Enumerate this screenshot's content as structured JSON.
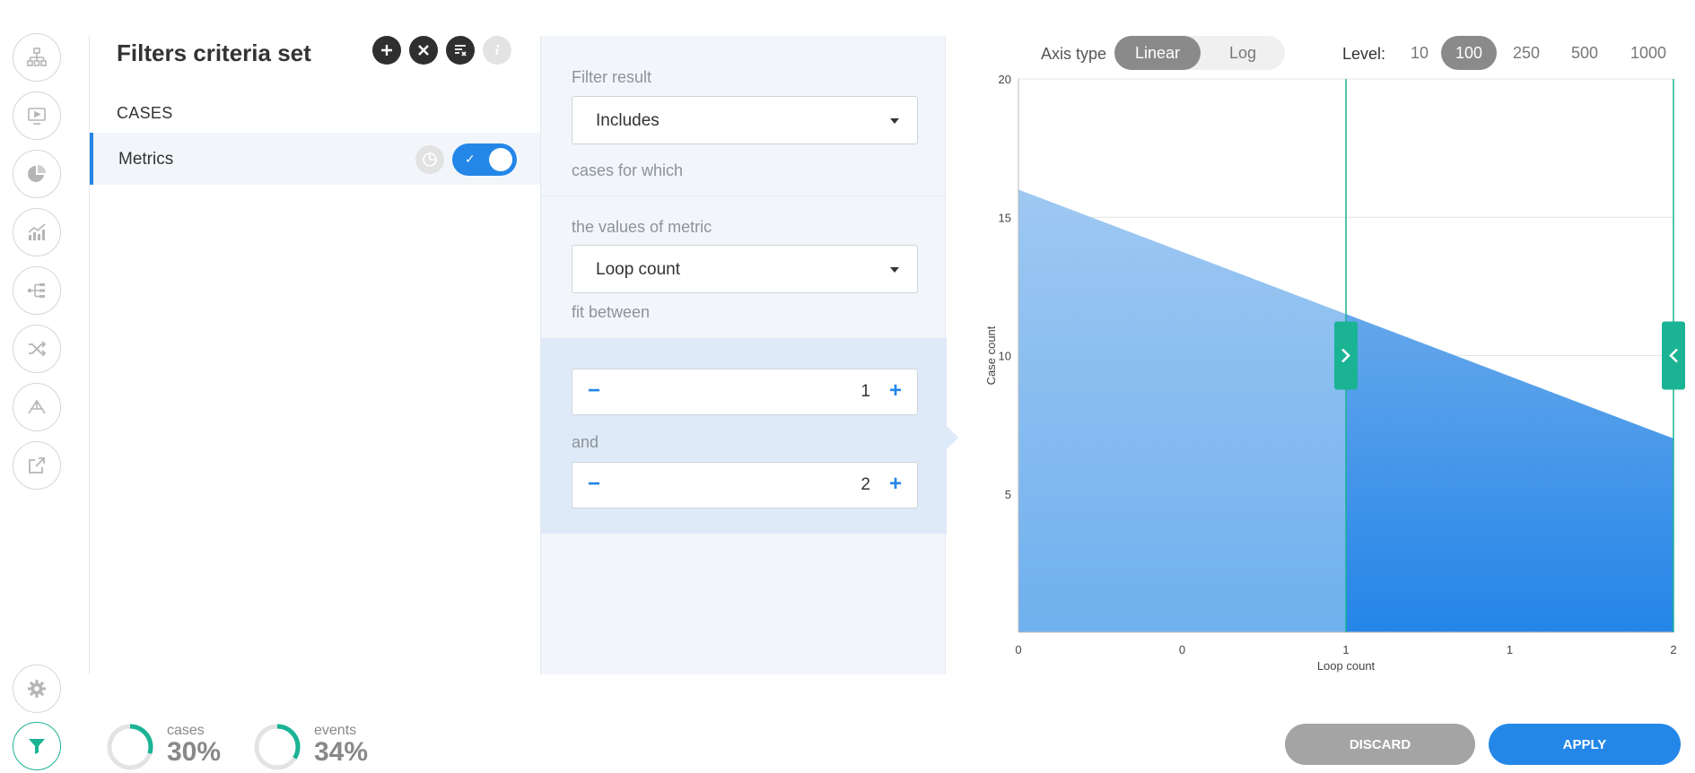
{
  "rail": {
    "items": [
      {
        "name": "process-map-icon"
      },
      {
        "name": "dashboard-icon"
      },
      {
        "name": "pie-chart-icon"
      },
      {
        "name": "statistics-icon"
      },
      {
        "name": "variants-icon"
      },
      {
        "name": "shuffle-icon"
      },
      {
        "name": "social-network-icon"
      },
      {
        "name": "export-icon"
      }
    ],
    "settings_icon": "gear-icon",
    "filter_icon": "filter-icon"
  },
  "filters": {
    "title": "Filters criteria set",
    "section": "CASES",
    "item_label": "Metrics",
    "toggle_on": true
  },
  "criteria": {
    "filter_result_label": "Filter result",
    "filter_result_value": "Includes",
    "cases_for_which": "cases for which",
    "metric_label": "the values of metric",
    "metric_value": "Loop count",
    "fit_between": "fit between",
    "min_value": "1",
    "and_label": "and",
    "max_value": "2",
    "minus": "−",
    "plus": "+"
  },
  "axis_type": {
    "label": "Axis type",
    "options": [
      "Linear",
      "Log"
    ],
    "selected": "Linear"
  },
  "level": {
    "label": "Level:",
    "options": [
      "10",
      "100",
      "250",
      "500",
      "1000"
    ],
    "selected": "100"
  },
  "chart_data": {
    "type": "area",
    "title": "",
    "xlabel": "Loop count",
    "ylabel": "Case count",
    "x": [
      0,
      2
    ],
    "values": [
      16,
      7
    ],
    "xticks": [
      "0",
      "0",
      "1",
      "1",
      "2"
    ],
    "yticks": [
      "5",
      "10",
      "15",
      "20"
    ],
    "ylim": [
      0,
      20
    ],
    "xlim": [
      0,
      2
    ],
    "selection": [
      1,
      2
    ],
    "grid": true,
    "colors": {
      "area": "#8cc0f1",
      "selected": "#2f8ae8",
      "handle": "#1ab394"
    }
  },
  "footer": {
    "cases_label": "cases",
    "cases_pct": "30%",
    "cases_frac": 0.3,
    "events_label": "events",
    "events_pct": "34%",
    "events_frac": 0.34,
    "discard": "DISCARD",
    "apply": "APPLY"
  }
}
